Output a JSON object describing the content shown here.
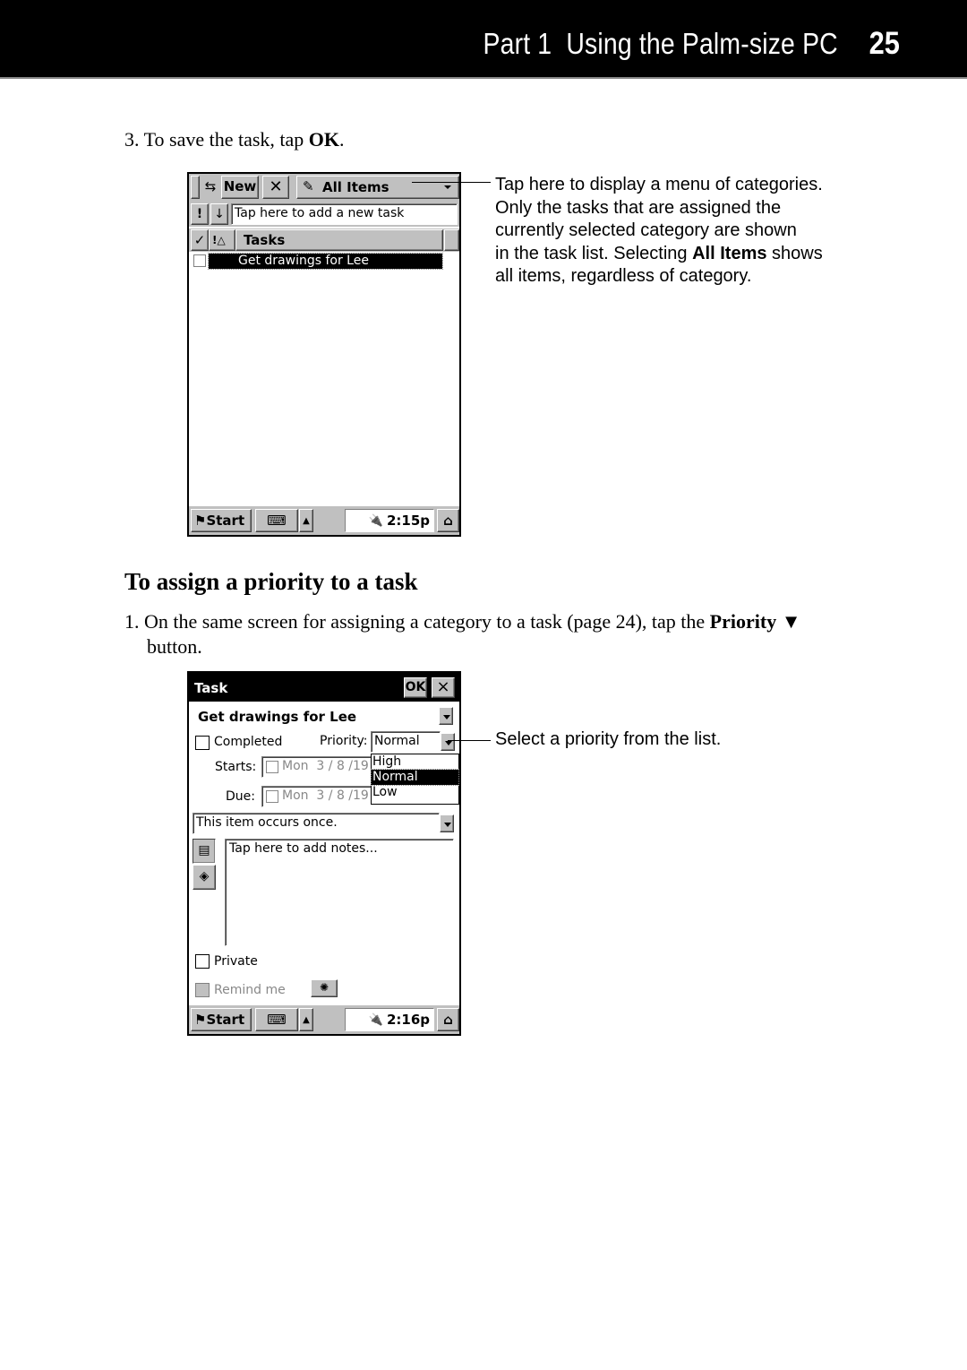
{
  "header": {
    "title": "Part 1  Using the Palm-size PC",
    "page_number": "25",
    "colors": {
      "bar": "#000000",
      "text": "#ffffff"
    }
  },
  "step3": {
    "number": "3.",
    "text_before": "To save the task, tap ",
    "bold": "OK",
    "text_after": "."
  },
  "screen1": {
    "toolbar": {
      "new_label": "New",
      "delete_icon": "x-icon",
      "category_label": "All Items"
    },
    "priority_sort_label": "!",
    "sort_arrow": "↓",
    "new_task_placeholder": "Tap here to add a new task",
    "list_header": {
      "check_col": "✓",
      "priority_col": "!",
      "sort_indicator": "△",
      "tasks_col": "Tasks"
    },
    "tasks": [
      {
        "title": "Get drawings for Lee",
        "completed": false,
        "selected": true
      }
    ],
    "taskbar": {
      "start_label": "Start",
      "time": "2:15p"
    }
  },
  "callout1": {
    "line1": "Tap here to display a menu of categories.",
    "line2": "Only the tasks that are assigned the",
    "line3": "currently selected category are shown",
    "line4_before": "in the task list. Selecting ",
    "line4_bold": "All Items",
    "line4_after": " shows",
    "line5": "all items, regardless of category."
  },
  "section": {
    "heading": "To assign a priority to a task",
    "step1_number": "1.",
    "step1_before": "On the same screen for assigning a category to a task (page 24), tap the ",
    "step1_bold": "Priority",
    "step1_arrow": "▼",
    "step1_line2": "button."
  },
  "screen2": {
    "title": "Task",
    "ok_label": "OK",
    "close_label": "×",
    "task_name": "Get drawings for Lee",
    "completed_label": "Completed",
    "priority_label": "Priority:",
    "priority_value": "Normal",
    "priority_options": [
      "High",
      "Normal",
      "Low"
    ],
    "priority_selected_index": 1,
    "starts_label": "Starts:",
    "starts_value": "Mon  3 / 8 /19",
    "due_label": "Due:",
    "due_value": "Mon  3 / 8 /19",
    "recurrence_value": "This item occurs once.",
    "notes_placeholder": "Tap here to add notes...",
    "private_label": "Private",
    "remind_label": "Remind me",
    "taskbar": {
      "start_label": "Start",
      "time": "2:16p"
    }
  },
  "callout2": {
    "text": "Select a priority from the list."
  }
}
